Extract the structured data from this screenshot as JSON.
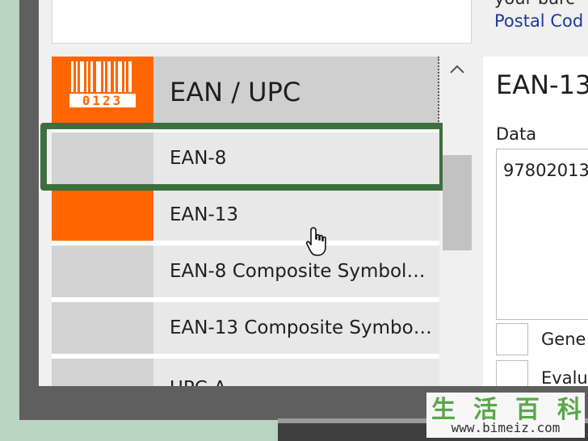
{
  "top_right": {
    "partial_text": "your barc",
    "link_text": "Postal Cod"
  },
  "list": {
    "header_label": "EAN / UPC",
    "header_barcode_digits": "0123",
    "items": [
      {
        "label": "EAN-8"
      },
      {
        "label": "EAN-13"
      },
      {
        "label": "EAN-8 Composite Symbol…"
      },
      {
        "label": "EAN-13 Composite Symbo…"
      },
      {
        "label": "UPC-A"
      }
    ]
  },
  "scrollbar": {
    "up_icon": "chevron-up-icon"
  },
  "right_panel": {
    "title": "EAN-13",
    "data_label": "Data",
    "data_value": "97802013",
    "checkbox_1_label": "Gene",
    "checkbox_2_label": "Evalu"
  },
  "watermark": {
    "chars": [
      "生",
      "活",
      "百",
      "科"
    ],
    "url": "www.bimeiz.com"
  },
  "colors": {
    "accent": "#ff6600",
    "selection": "#3d6e3d",
    "link": "#1e3a99"
  }
}
